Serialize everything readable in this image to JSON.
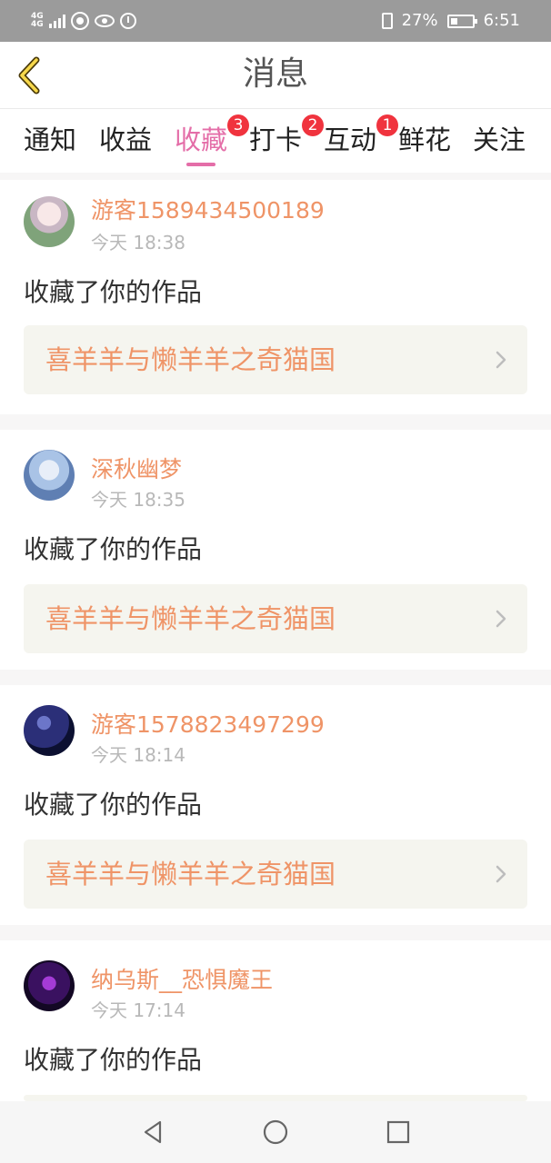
{
  "status_bar": {
    "network_top": "4G",
    "network_bottom": "4G",
    "battery": "27%",
    "time": "6:51",
    "icons": [
      "signal-icon",
      "hd-call-icon",
      "eye-icon",
      "alarm-icon",
      "vibrate-icon",
      "battery-icon"
    ]
  },
  "header": {
    "title": "消息",
    "back_icon": "chevron-left-icon"
  },
  "tabs": [
    {
      "label": "通知",
      "badge": "",
      "active": false
    },
    {
      "label": "收益",
      "badge": "",
      "active": false
    },
    {
      "label": "收藏",
      "badge": "3",
      "active": true
    },
    {
      "label": "打卡",
      "badge": "2",
      "active": false
    },
    {
      "label": "互动",
      "badge": "1",
      "active": false
    },
    {
      "label": "鲜花",
      "badge": "",
      "active": false
    },
    {
      "label": "关注",
      "badge": "",
      "active": false
    }
  ],
  "messages": [
    {
      "username": "游客1589434500189",
      "time": "今天 18:38",
      "action": "收藏了你的作品",
      "work": "喜羊羊与懒羊羊之奇猫国",
      "avatar": "anime-girl-avatar"
    },
    {
      "username": "深秋幽梦",
      "time": "今天 18:35",
      "action": "收藏了你的作品",
      "work": "喜羊羊与懒羊羊之奇猫国",
      "avatar": "ice-princess-avatar"
    },
    {
      "username": "游客1578823497299",
      "time": "今天 18:14",
      "action": "收藏了你的作品",
      "work": "喜羊羊与懒羊羊之奇猫国",
      "avatar": "night-sky-avatar"
    },
    {
      "username": "纳乌斯__恐惧魔王",
      "time": "今天 17:14",
      "action": "收藏了你的作品",
      "work": "",
      "avatar": "dark-figure-avatar"
    }
  ],
  "colors": {
    "accent_pink": "#e46ea8",
    "username_orange": "#ef9467",
    "badge_red": "#f0333e",
    "card_bg": "#f5f5ef"
  },
  "nav": [
    "back-triangle-icon",
    "home-circle-icon",
    "recents-square-icon"
  ]
}
